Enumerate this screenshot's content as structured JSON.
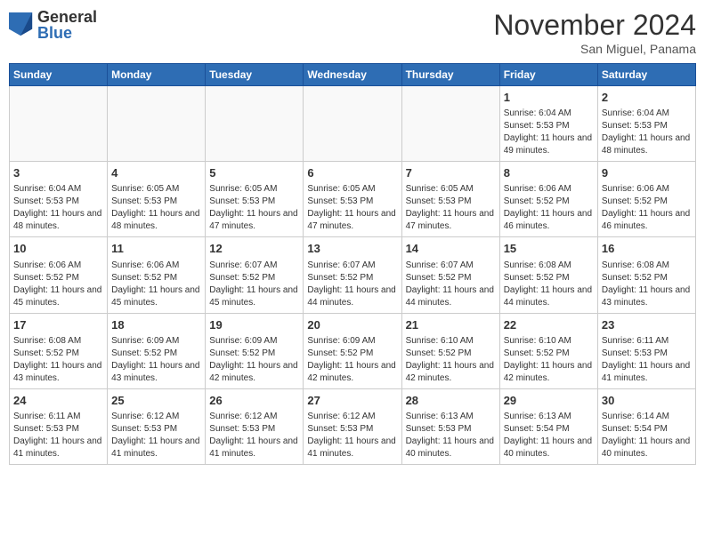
{
  "header": {
    "logo_general": "General",
    "logo_blue": "Blue",
    "month_title": "November 2024",
    "location": "San Miguel, Panama"
  },
  "calendar": {
    "days_of_week": [
      "Sunday",
      "Monday",
      "Tuesday",
      "Wednesday",
      "Thursday",
      "Friday",
      "Saturday"
    ],
    "weeks": [
      [
        {
          "day": "",
          "info": ""
        },
        {
          "day": "",
          "info": ""
        },
        {
          "day": "",
          "info": ""
        },
        {
          "day": "",
          "info": ""
        },
        {
          "day": "",
          "info": ""
        },
        {
          "day": "1",
          "info": "Sunrise: 6:04 AM\nSunset: 5:53 PM\nDaylight: 11 hours and 49 minutes."
        },
        {
          "day": "2",
          "info": "Sunrise: 6:04 AM\nSunset: 5:53 PM\nDaylight: 11 hours and 48 minutes."
        }
      ],
      [
        {
          "day": "3",
          "info": "Sunrise: 6:04 AM\nSunset: 5:53 PM\nDaylight: 11 hours and 48 minutes."
        },
        {
          "day": "4",
          "info": "Sunrise: 6:05 AM\nSunset: 5:53 PM\nDaylight: 11 hours and 48 minutes."
        },
        {
          "day": "5",
          "info": "Sunrise: 6:05 AM\nSunset: 5:53 PM\nDaylight: 11 hours and 47 minutes."
        },
        {
          "day": "6",
          "info": "Sunrise: 6:05 AM\nSunset: 5:53 PM\nDaylight: 11 hours and 47 minutes."
        },
        {
          "day": "7",
          "info": "Sunrise: 6:05 AM\nSunset: 5:53 PM\nDaylight: 11 hours and 47 minutes."
        },
        {
          "day": "8",
          "info": "Sunrise: 6:06 AM\nSunset: 5:52 PM\nDaylight: 11 hours and 46 minutes."
        },
        {
          "day": "9",
          "info": "Sunrise: 6:06 AM\nSunset: 5:52 PM\nDaylight: 11 hours and 46 minutes."
        }
      ],
      [
        {
          "day": "10",
          "info": "Sunrise: 6:06 AM\nSunset: 5:52 PM\nDaylight: 11 hours and 45 minutes."
        },
        {
          "day": "11",
          "info": "Sunrise: 6:06 AM\nSunset: 5:52 PM\nDaylight: 11 hours and 45 minutes."
        },
        {
          "day": "12",
          "info": "Sunrise: 6:07 AM\nSunset: 5:52 PM\nDaylight: 11 hours and 45 minutes."
        },
        {
          "day": "13",
          "info": "Sunrise: 6:07 AM\nSunset: 5:52 PM\nDaylight: 11 hours and 44 minutes."
        },
        {
          "day": "14",
          "info": "Sunrise: 6:07 AM\nSunset: 5:52 PM\nDaylight: 11 hours and 44 minutes."
        },
        {
          "day": "15",
          "info": "Sunrise: 6:08 AM\nSunset: 5:52 PM\nDaylight: 11 hours and 44 minutes."
        },
        {
          "day": "16",
          "info": "Sunrise: 6:08 AM\nSunset: 5:52 PM\nDaylight: 11 hours and 43 minutes."
        }
      ],
      [
        {
          "day": "17",
          "info": "Sunrise: 6:08 AM\nSunset: 5:52 PM\nDaylight: 11 hours and 43 minutes."
        },
        {
          "day": "18",
          "info": "Sunrise: 6:09 AM\nSunset: 5:52 PM\nDaylight: 11 hours and 43 minutes."
        },
        {
          "day": "19",
          "info": "Sunrise: 6:09 AM\nSunset: 5:52 PM\nDaylight: 11 hours and 42 minutes."
        },
        {
          "day": "20",
          "info": "Sunrise: 6:09 AM\nSunset: 5:52 PM\nDaylight: 11 hours and 42 minutes."
        },
        {
          "day": "21",
          "info": "Sunrise: 6:10 AM\nSunset: 5:52 PM\nDaylight: 11 hours and 42 minutes."
        },
        {
          "day": "22",
          "info": "Sunrise: 6:10 AM\nSunset: 5:52 PM\nDaylight: 11 hours and 42 minutes."
        },
        {
          "day": "23",
          "info": "Sunrise: 6:11 AM\nSunset: 5:53 PM\nDaylight: 11 hours and 41 minutes."
        }
      ],
      [
        {
          "day": "24",
          "info": "Sunrise: 6:11 AM\nSunset: 5:53 PM\nDaylight: 11 hours and 41 minutes."
        },
        {
          "day": "25",
          "info": "Sunrise: 6:12 AM\nSunset: 5:53 PM\nDaylight: 11 hours and 41 minutes."
        },
        {
          "day": "26",
          "info": "Sunrise: 6:12 AM\nSunset: 5:53 PM\nDaylight: 11 hours and 41 minutes."
        },
        {
          "day": "27",
          "info": "Sunrise: 6:12 AM\nSunset: 5:53 PM\nDaylight: 11 hours and 41 minutes."
        },
        {
          "day": "28",
          "info": "Sunrise: 6:13 AM\nSunset: 5:53 PM\nDaylight: 11 hours and 40 minutes."
        },
        {
          "day": "29",
          "info": "Sunrise: 6:13 AM\nSunset: 5:54 PM\nDaylight: 11 hours and 40 minutes."
        },
        {
          "day": "30",
          "info": "Sunrise: 6:14 AM\nSunset: 5:54 PM\nDaylight: 11 hours and 40 minutes."
        }
      ]
    ]
  }
}
